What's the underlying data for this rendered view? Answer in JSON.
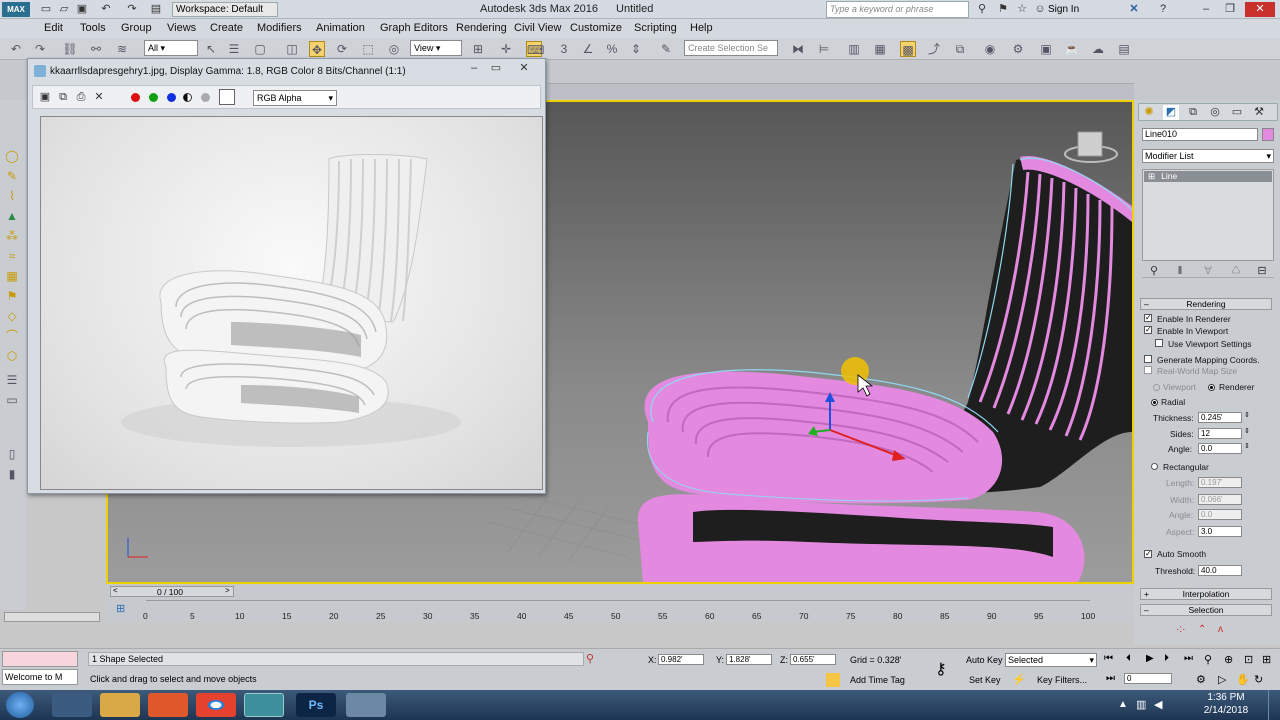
{
  "titlebar": {
    "workspace": "Workspace: Default",
    "app_title": "Autodesk 3ds Max 2016",
    "doc_title": "Untitled",
    "search_placeholder": "Type a keyword or phrase",
    "sign_in": "Sign In"
  },
  "menu": [
    "Edit",
    "Tools",
    "Group",
    "Views",
    "Create",
    "Modifiers",
    "Animation",
    "Graph Editors",
    "Rendering",
    "Civil View",
    "Customize",
    "Scripting",
    "Help"
  ],
  "toolbar": {
    "filter_value": "All",
    "refcoord_value": "View",
    "selset_placeholder": "Create Selection Se"
  },
  "dialog": {
    "title": "kkaarrllsdapresgehry1.jpg, Display Gamma: 1.8, RGB Color 8 Bits/Channel (1:1)",
    "channel_value": "RGB Alpha"
  },
  "cmdpanel": {
    "object_name": "Line010",
    "modifier_list": "Modifier List",
    "stack_item": "Line",
    "rendering_title": "Rendering",
    "enable_in_renderer": "Enable In Renderer",
    "enable_in_viewport": "Enable In Viewport",
    "use_viewport_settings": "Use Viewport Settings",
    "generate_mapping": "Generate Mapping Coords.",
    "real_world_map": "Real-World Map Size",
    "viewport_radio": "Viewport",
    "renderer_radio": "Renderer",
    "radial": "Radial",
    "thickness_label": "Thickness:",
    "thickness_value": "0.245'",
    "sides_label": "Sides:",
    "sides_value": "12",
    "angle_label": "Angle:",
    "angle_value": "0.0",
    "rectangular": "Rectangular",
    "length_label": "Length:",
    "length_value": "0.197'",
    "width_label": "Width:",
    "width_value": "0.066'",
    "angle2_label": "Angle:",
    "angle2_value": "0.0",
    "aspect_label": "Aspect:",
    "aspect_value": "3.0",
    "auto_smooth": "Auto Smooth",
    "threshold_label": "Threshold:",
    "threshold_value": "40.0",
    "interpolation": "Interpolation",
    "selection": "Selection"
  },
  "timeline": {
    "frame_display": "0 / 100",
    "ticks": [
      "0",
      "5",
      "10",
      "15",
      "20",
      "25",
      "30",
      "35",
      "40",
      "45",
      "50",
      "55",
      "60",
      "65",
      "70",
      "75",
      "80",
      "85",
      "90",
      "95",
      "100"
    ]
  },
  "status": {
    "selected_info": "1 Shape Selected",
    "prompt": "Click and drag to select and move objects",
    "welcome": "Welcome to M",
    "x_label": "X:",
    "x_value": "0.982'",
    "y_label": "Y:",
    "y_value": "1.828'",
    "z_label": "Z:",
    "z_value": "0.655'",
    "grid": "Grid = 0.328'",
    "add_time_tag": "Add Time Tag",
    "auto_key": "Auto Key",
    "set_key": "Set Key",
    "key_mode_value": "Selected",
    "key_filters": "Key Filters...",
    "frame_field": "0"
  },
  "taskbar": {
    "time": "1:36 PM",
    "date": "2/14/2018"
  },
  "colors": {
    "accent_yellow": "#f0d100",
    "spline_pink": "#e38ae0",
    "taskbar": "#1d3552"
  }
}
